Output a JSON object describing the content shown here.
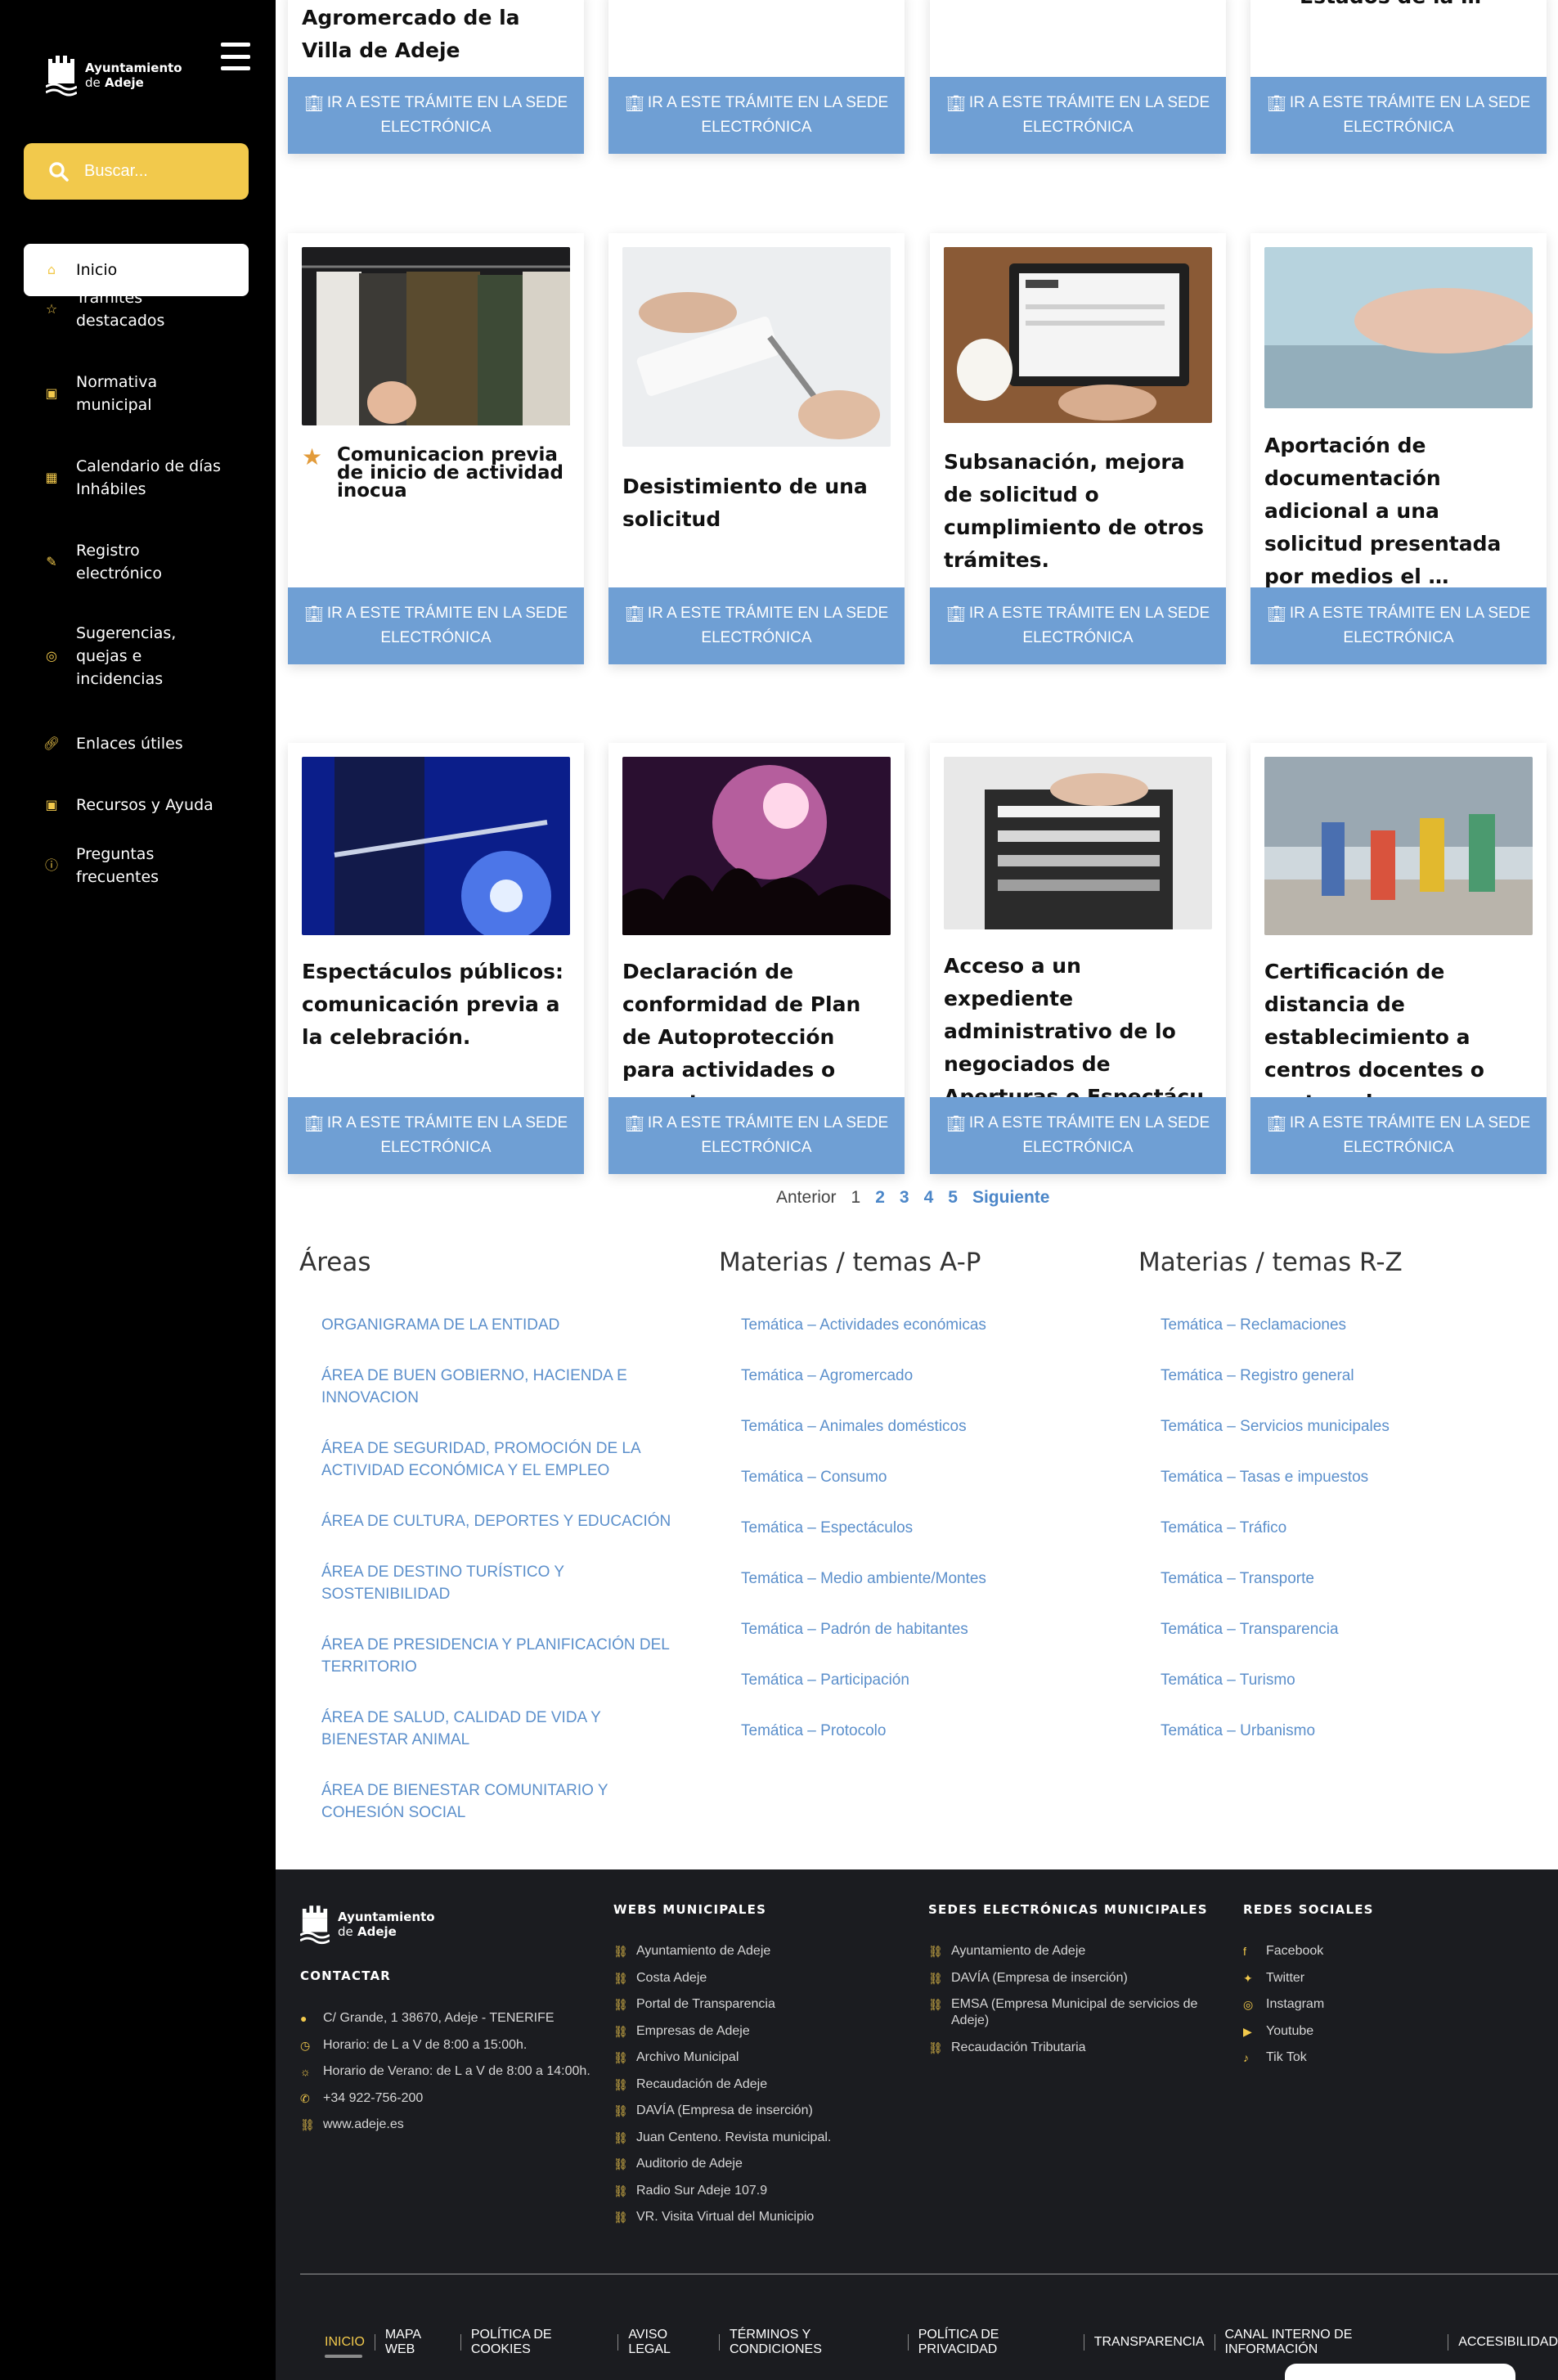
{
  "sidebar": {
    "logo": {
      "line1": "Ayuntamiento",
      "line2_small": "de",
      "line2_bold": "Adeje"
    },
    "search_placeholder": "Buscar...",
    "items": [
      {
        "label": "Inicio",
        "icon": "home-icon"
      },
      {
        "label": "Trámites destacados",
        "icon": "star-icon"
      },
      {
        "label": "Normativa municipal",
        "icon": "document-icon"
      },
      {
        "label": "Calendario de días Inhábiles",
        "icon": "calendar-icon"
      },
      {
        "label": "Registro electrónico",
        "icon": "edit-icon"
      },
      {
        "label": "Sugerencias, quejas e incidencias",
        "icon": "support-icon"
      },
      {
        "label": "Enlaces útiles",
        "icon": "link-icon"
      },
      {
        "label": "Recursos y Ayuda",
        "icon": "help-book-icon"
      },
      {
        "label": "Preguntas frecuentes",
        "icon": "question-icon"
      }
    ]
  },
  "cta_label": "IR A ESTE TRÁMITE EN LA SEDE ELECTRÓNICA",
  "cards": {
    "row0": [
      {
        "title": "Agromercado de la Villa de Adeje"
      },
      {
        "title": ""
      },
      {
        "title": ""
      },
      {
        "title": "Estados de la …"
      }
    ],
    "row1": [
      {
        "title": "Comunicacion previa de inicio de actividad inocua",
        "featured": true
      },
      {
        "title": "Desistimiento de una solicitud"
      },
      {
        "title": "Subsanación, mejora de solicitud o cumplimiento de otros trámites."
      },
      {
        "title": "Aportación de documentación adicional a una solicitud presentada por medios el …"
      }
    ],
    "row2": [
      {
        "title": "Espectáculos públicos: comunicación previa a la celebración."
      },
      {
        "title": "Declaración de conformidad de Plan de Autoprotección para actividades o espect …"
      },
      {
        "title": "Acceso a un expediente administrativo de lo negociados de Aperturas o Espectácu …"
      },
      {
        "title": "Certificación de distancia de establecimiento a centros docentes o centros de a …"
      }
    ]
  },
  "pager": {
    "prev": "Anterior",
    "current": "1",
    "pages": [
      "2",
      "3",
      "4",
      "5"
    ],
    "next": "Siguiente"
  },
  "areas": {
    "title": "Áreas",
    "items": [
      "ORGANIGRAMA DE LA ENTIDAD",
      "ÁREA DE BUEN GOBIERNO, HACIENDA E INNOVACION",
      "ÁREA DE SEGURIDAD, PROMOCIÓN DE LA ACTIVIDAD ECONÓMICA Y EL EMPLEO",
      "ÁREA DE CULTURA, DEPORTES Y EDUCACIÓN",
      "ÁREA DE DESTINO TURÍSTICO Y SOSTENIBILIDAD",
      "ÁREA DE PRESIDENCIA Y PLANIFICACIÓN DEL TERRITORIO",
      "ÁREA DE SALUD, CALIDAD DE VIDA Y BIENESTAR ANIMAL",
      "ÁREA DE BIENESTAR COMUNITARIO Y COHESIÓN SOCIAL"
    ]
  },
  "temas_ap": {
    "title": "Materias / temas A-P",
    "items": [
      "Temática – Actividades económicas",
      "Temática – Agromercado",
      "Temática – Animales domésticos",
      "Temática – Consumo",
      "Temática – Espectáculos",
      "Temática – Medio ambiente/Montes",
      "Temática – Padrón de habitantes",
      "Temática – Participación",
      "Temática – Protocolo"
    ]
  },
  "temas_rz": {
    "title": "Materias / temas R-Z",
    "items": [
      "Temática – Reclamaciones",
      "Temática – Registro general",
      "Temática – Servicios municipales",
      "Temática – Tasas e impuestos",
      "Temática – Tráfico",
      "Temática – Transporte",
      "Temática – Transparencia",
      "Temática – Turismo",
      "Temática – Urbanismo"
    ]
  },
  "footer": {
    "contact_title": "CONTACTAR",
    "contact": [
      "C/ Grande, 1 38670, Adeje - TENERIFE",
      "Horario: de L a V de 8:00 a 15:00h.",
      "Horario de Verano: de L a V de 8:00 a 14:00h.",
      "+34 922-756-200",
      "www.adeje.es"
    ],
    "webs_title": "WEBS MUNICIPALES",
    "webs": [
      "Ayuntamiento de Adeje",
      "Costa Adeje",
      "Portal de Transparencia",
      "Empresas de Adeje",
      "Archivo Municipal",
      "Recaudación de Adeje",
      "DAVÍA (Empresa de inserción)",
      "Juan Centeno. Revista municipal.",
      "Auditorio de Adeje",
      "Radio Sur Adeje 107.9",
      "VR. Visita Virtual del Municipio"
    ],
    "sedes_title": "SEDES ELECTRÓNICAS MUNICIPALES",
    "sedes": [
      "Ayuntamiento de Adeje",
      "DAVÍA (Empresa de inserción)",
      "EMSA (Empresa Municipal de servicios de Adeje)",
      "Recaudación Tributaria"
    ],
    "redes_title": "REDES SOCIALES",
    "redes": [
      "Facebook",
      "Twitter",
      "Instagram",
      "Youtube",
      "Tik Tok"
    ],
    "bottom_links": [
      "INICIO",
      "MAPA WEB",
      "POLÍTICA DE COOKIES",
      "AVISO LEGAL",
      "TÉRMINOS Y CONDICIONES",
      "POLÍTICA DE PRIVACIDAD",
      "TRANSPARENCIA",
      "CANAL INTERNO DE INFORMACIÓN",
      "ACCESIBILIDAD"
    ]
  },
  "colors": {
    "accent": "#f2c94c",
    "cta": "#6f9fd4",
    "link": "#5b8fcb",
    "sidebar": "#000000",
    "footer": "#1b1c20"
  }
}
